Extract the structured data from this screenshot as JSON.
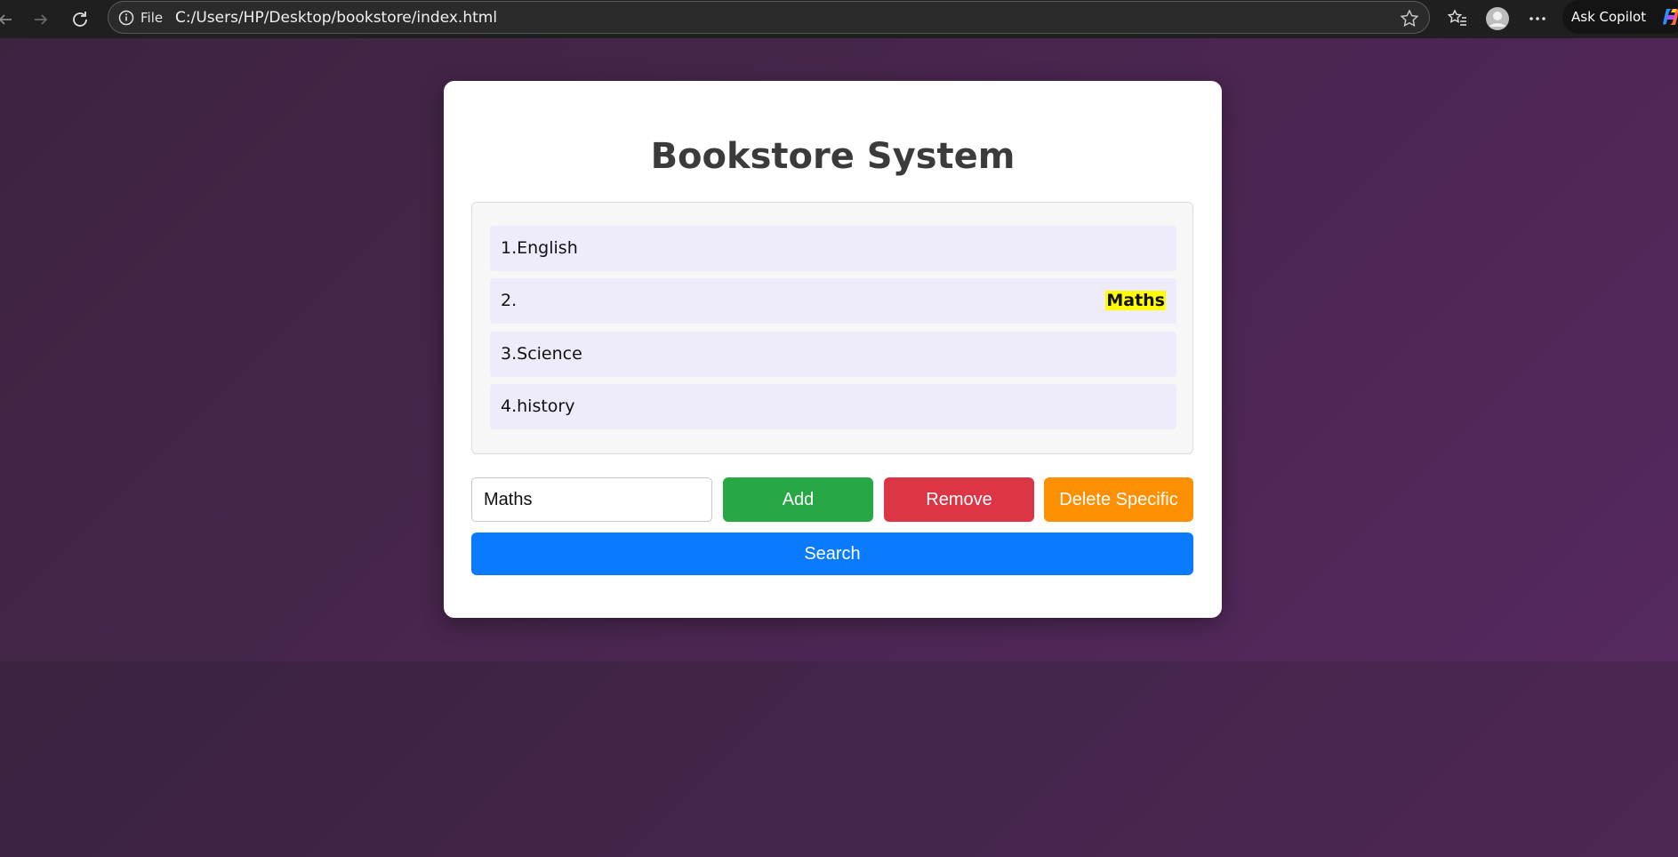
{
  "browser": {
    "address_scheme": "File",
    "url": "C:/Users/HP/Desktop/bookstore/index.html",
    "copilot_label": "Ask Copilot",
    "icons": [
      "back-icon",
      "forward-icon",
      "refresh-icon",
      "info-icon",
      "star-icon",
      "favorites-icon",
      "profile-icon",
      "more-icon",
      "copilot-icon"
    ]
  },
  "page": {
    "title": "Bookstore System",
    "books": [
      {
        "text": "1.English",
        "highlight": ""
      },
      {
        "text": "2.",
        "highlight": "Maths"
      },
      {
        "text": "3.Science",
        "highlight": ""
      },
      {
        "text": "4.history",
        "highlight": ""
      }
    ],
    "input_value": "Maths",
    "buttons": {
      "add": "Add",
      "remove": "Remove",
      "delete_specific": "Delete Specific",
      "search": "Search"
    }
  },
  "colors": {
    "add": "#28a745",
    "remove": "#dc3545",
    "delete_specific": "#fd8f02",
    "search": "#0a7bff",
    "highlight": "#ffff00"
  }
}
